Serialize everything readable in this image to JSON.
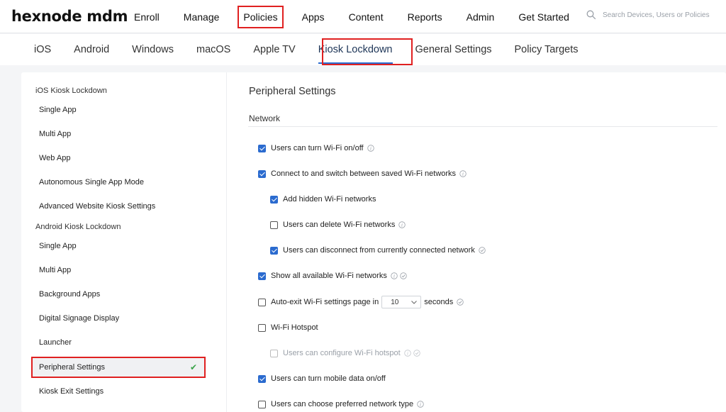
{
  "app": {
    "logo": "hexnode mdm"
  },
  "topnav": {
    "items": [
      {
        "label": "Enroll"
      },
      {
        "label": "Manage"
      },
      {
        "label": "Policies"
      },
      {
        "label": "Apps"
      },
      {
        "label": "Content"
      },
      {
        "label": "Reports"
      },
      {
        "label": "Admin"
      },
      {
        "label": "Get Started"
      }
    ],
    "search_placeholder": "Search Devices, Users or Policies"
  },
  "subnav": {
    "tabs": [
      {
        "label": "iOS"
      },
      {
        "label": "Android"
      },
      {
        "label": "Windows"
      },
      {
        "label": "macOS"
      },
      {
        "label": "Apple TV"
      },
      {
        "label": "Kiosk Lockdown"
      },
      {
        "label": "General Settings"
      },
      {
        "label": "Policy Targets"
      }
    ]
  },
  "sidebar": {
    "ios_header": "iOS Kiosk Lockdown",
    "ios_items": [
      {
        "label": "Single App"
      },
      {
        "label": "Multi App"
      },
      {
        "label": "Web App"
      },
      {
        "label": "Autonomous Single App Mode"
      },
      {
        "label": "Advanced Website Kiosk Settings"
      }
    ],
    "android_header": "Android Kiosk Lockdown",
    "android_items": [
      {
        "label": "Single App"
      },
      {
        "label": "Multi App"
      },
      {
        "label": "Background Apps"
      },
      {
        "label": "Digital Signage Display"
      },
      {
        "label": "Launcher"
      },
      {
        "label": "Peripheral Settings"
      },
      {
        "label": "Kiosk Exit Settings"
      }
    ]
  },
  "main": {
    "title": "Peripheral Settings",
    "section": "Network",
    "options": [
      {
        "label": "Users can turn Wi-Fi on/off",
        "checked": true
      },
      {
        "label": "Connect to and switch between saved Wi-Fi networks",
        "checked": true
      },
      {
        "label": "Add hidden Wi-Fi networks",
        "checked": true
      },
      {
        "label": "Users can delete Wi-Fi networks",
        "checked": false
      },
      {
        "label": "Users can disconnect from currently connected network",
        "checked": true
      },
      {
        "label": "Show all available Wi-Fi networks",
        "checked": true
      },
      {
        "label": "Auto-exit Wi-Fi settings page in",
        "checked": false,
        "select_value": "10",
        "suffix": "seconds"
      },
      {
        "label": "Wi-Fi Hotspot",
        "checked": false
      },
      {
        "label": "Users can configure Wi-Fi hotspot",
        "checked": false,
        "disabled": true
      },
      {
        "label": "Users can turn mobile data on/off",
        "checked": true
      },
      {
        "label": "Users can choose preferred network type",
        "checked": false
      }
    ]
  },
  "colors": {
    "accent": "#2b6bcf",
    "highlight": "#e02020",
    "success": "#3aa34a"
  }
}
